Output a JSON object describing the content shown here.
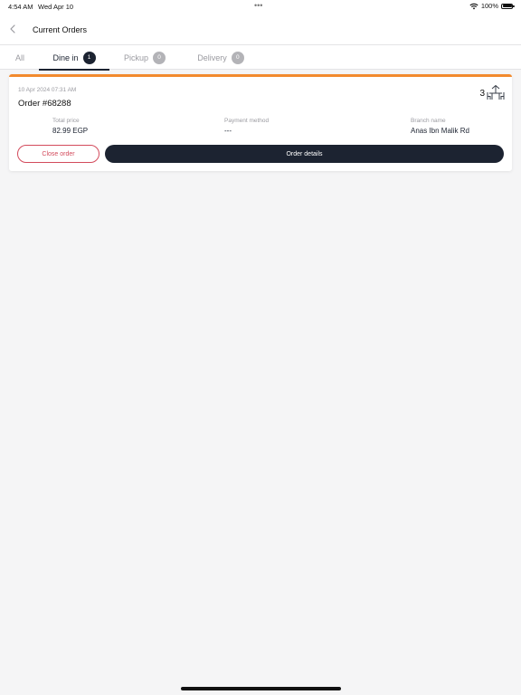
{
  "status_bar": {
    "time": "4:54 AM",
    "date": "Wed Apr 10",
    "dots": "•••",
    "battery": "100%"
  },
  "header": {
    "title": "Current Orders",
    "back_icon": "chevron-left-icon"
  },
  "tabs": [
    {
      "label": "All",
      "active": false
    },
    {
      "label": "Dine in",
      "count": "1",
      "active": true
    },
    {
      "label": "Pickup",
      "count": "0",
      "active": false
    },
    {
      "label": "Delivery",
      "count": "0",
      "active": false
    }
  ],
  "order": {
    "timestamp": "10 Apr 2024 07:31 AM",
    "number": "Order #68288",
    "table_count": "3",
    "table_icon": "dine-table-icon",
    "total_price_label": "Total price",
    "total_price": "82.99 EGP",
    "payment_method_label": "Payment method",
    "payment_method": "---",
    "branch_label": "Branch name",
    "branch": "Anas Ibn Malik Rd",
    "close_label": "Close order",
    "details_label": "Order details"
  },
  "colors": {
    "accent": "#f28a2e",
    "primary": "#1c2331",
    "danger": "#d34b5c",
    "background": "#f5f5f6"
  }
}
